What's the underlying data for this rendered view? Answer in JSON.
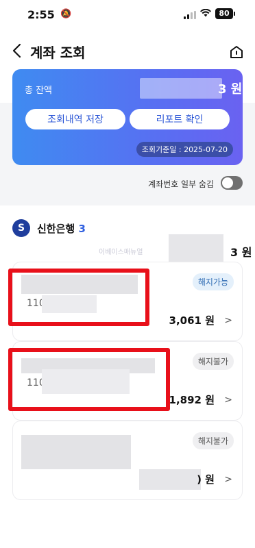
{
  "status": {
    "time": "2:55",
    "battery": "80"
  },
  "header": {
    "title": "계좌 조회"
  },
  "card": {
    "label": "총 잔액",
    "amount_tail": "3 원",
    "save_btn": "조회내역 저장",
    "report_btn": "리포트 확인",
    "ref_date": "조회기준일 : 2025-07-20"
  },
  "toggle": {
    "label": "계좌번호 일부 숨김",
    "on": false
  },
  "bank": {
    "name": "신한은행",
    "count": "3",
    "logo": "S",
    "watermark": "이베이스매뉴얼",
    "total_tail": "3 원"
  },
  "accounts": [
    {
      "number_prefix": "110",
      "status": "해지가능",
      "balance": "3,061 원"
    },
    {
      "number_prefix": "110",
      "status": "해지불가",
      "balance": "1,892 원"
    },
    {
      "number_prefix": "",
      "status": "해지불가",
      "balance_tail": ") 원"
    }
  ],
  "colors": {
    "card_start": "#3f8bf1",
    "card_end": "#6a62f1",
    "highlight": "#e8101a",
    "accent": "#2f5fe0"
  },
  "icons": [
    "bell-slash-icon",
    "signal-icon",
    "wifi-icon",
    "battery-icon",
    "back-arrow-icon",
    "home-icon",
    "chevron-right-icon"
  ]
}
